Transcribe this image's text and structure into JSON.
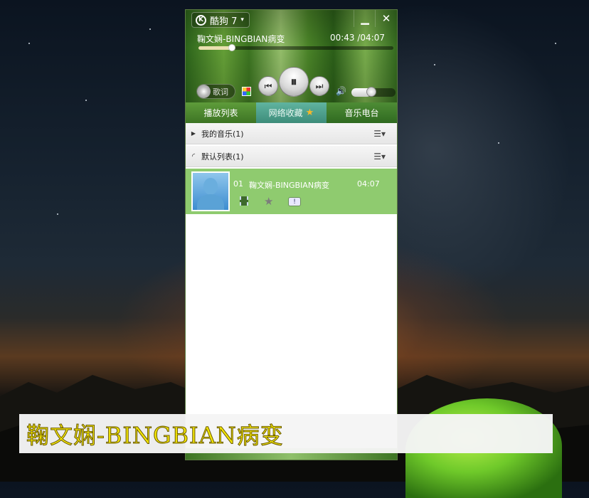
{
  "player": {
    "brand": "酷狗 7",
    "brand_logo": "K",
    "now_playing": {
      "title": "鞠文娴-BINGBIAN病变",
      "time": "00:43 /04:07",
      "progress_fraction": 0.17
    },
    "lyric_button": "歌词",
    "volume_fraction": 0.45,
    "window_buttons": {
      "minimize": "▁",
      "close": "✕"
    },
    "tabs": [
      {
        "label": "播放列表"
      },
      {
        "label": "网络收藏",
        "icon": "star-icon"
      },
      {
        "label": "音乐电台"
      }
    ],
    "groups": [
      {
        "label": "我的音乐(1)"
      },
      {
        "label": "默认列表(1)"
      }
    ],
    "track": {
      "index": "01",
      "title": "鞠文娴-BINGBIAN病变",
      "duration": "04:07",
      "info_badge": "!"
    }
  },
  "subtitle": "鞠文娴-BINGBIAN病变",
  "colors": {
    "accent": "#5e9c3a",
    "highlight_row": "#8fcb6f",
    "subtitle_text": "#f3e600"
  }
}
